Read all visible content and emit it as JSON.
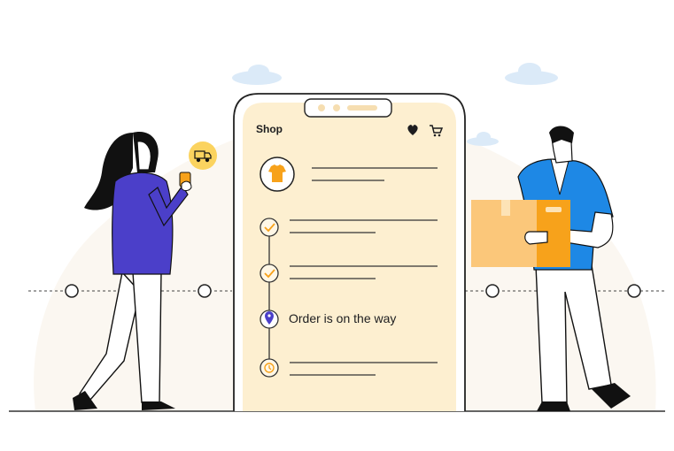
{
  "phone": {
    "title": "Shop",
    "header_icons": [
      "heart-icon",
      "cart-icon"
    ]
  },
  "order": {
    "product_icon": "tshirt-icon",
    "steps": [
      {
        "state": "done",
        "icon": "check-icon",
        "label": ""
      },
      {
        "state": "done",
        "icon": "check-icon",
        "label": ""
      },
      {
        "state": "current",
        "icon": "location-pin-icon",
        "label": "Order is on the way"
      },
      {
        "state": "pending",
        "icon": "clock-icon",
        "label": ""
      }
    ]
  },
  "colors": {
    "phone_screen": "#fdefd0",
    "accent_orange": "#f7a21b",
    "accent_purple": "#4b3fc9",
    "accent_blue": "#1e88e5",
    "box": "#fbc77a",
    "backdrop": "#fbf7f1",
    "cloud": "#dbeaf8"
  }
}
